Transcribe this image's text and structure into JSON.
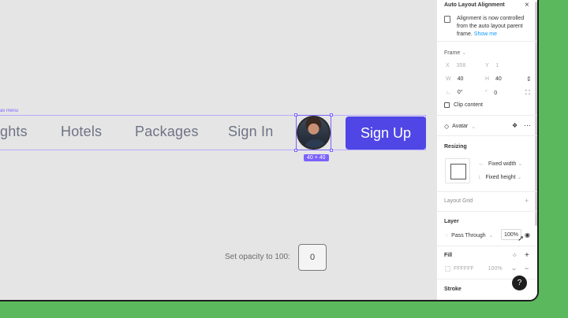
{
  "canvas": {
    "frame_label": "av menu",
    "nav_items": [
      "ghts",
      "Hotels",
      "Packages",
      "Sign In"
    ],
    "size_badge": "40 × 40",
    "signup_label": "Sign Up",
    "opacity_hint": "Set opacity to 100:",
    "key_label": "0"
  },
  "panel": {
    "notice_title": "Auto Layout Alignment",
    "notice_text": "Alignment is now controlled from the auto layout parent frame.",
    "notice_link": "Show me",
    "frame_label": "Frame",
    "x_label": "X",
    "x_value": "358",
    "y_label": "Y",
    "y_value": "1",
    "w_label": "W",
    "w_value": "40",
    "h_label": "H",
    "h_value": "40",
    "rotation_value": "0°",
    "radius_value": "0",
    "clip_content": "Clip content",
    "component_name": "Avatar",
    "resizing_title": "Resizing",
    "fixed_width": "Fixed width",
    "fixed_height": "Fixed height",
    "layout_grid": "Layout Grid",
    "layer_title": "Layer",
    "blend_mode": "Pass Through",
    "layer_opacity": "100%",
    "fill_title": "Fill",
    "fill_hex": "FFFFFF",
    "fill_opacity": "100%",
    "stroke_title": "Stroke"
  },
  "help_label": "?",
  "colors": {
    "accent": "#7b61ff",
    "button": "#4f46e5",
    "desktop": "#5cb85c"
  }
}
